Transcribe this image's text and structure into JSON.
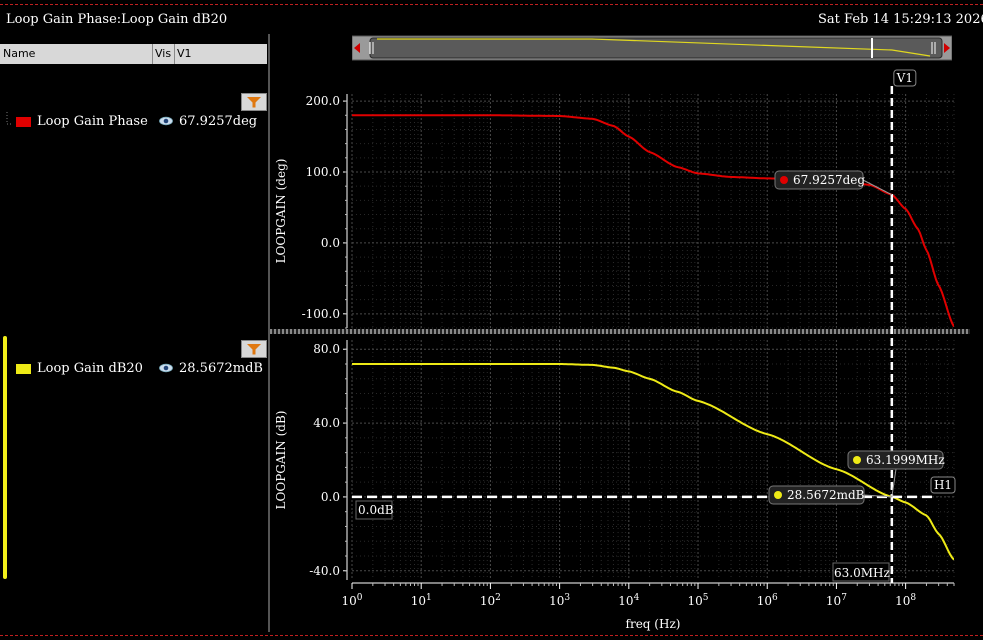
{
  "window": {
    "title": "Loop Gain Phase:Loop Gain dB20",
    "datetime": "Sat Feb 14 15:29:13 2026",
    "corner_text": "1"
  },
  "legend_header": {
    "name": "Name",
    "vis": "Vis",
    "v1": "V1"
  },
  "legend": [
    {
      "name": "Loop Gain Phase",
      "value": "67.9257deg",
      "color": "#e00000"
    },
    {
      "name": "Loop Gain dB20",
      "value": "28.5672mdB",
      "color": "#eeea16"
    }
  ],
  "markers": {
    "v1_label": "V1",
    "h1_label": "H1",
    "phase_readout": "67.9257deg",
    "freq_readout": "63.1999MHz",
    "gain_readout": "28.5672mdB",
    "h1_value_label": "0.0dB",
    "v1_freq_label": "63.0MHz"
  },
  "chart_data": [
    {
      "type": "line",
      "title": "",
      "xlabel": "freq (Hz)",
      "ylabel": "LOOPGAIN (deg)",
      "xscale": "log",
      "xlim": [
        1,
        500000000
      ],
      "ylim": [
        -120,
        210
      ],
      "yticks": [
        -100,
        0,
        100,
        200
      ],
      "ytick_labels": [
        "-100.0",
        "0.0",
        "100.0",
        "200.0"
      ],
      "grid": true,
      "series": [
        {
          "name": "Loop Gain Phase",
          "color": "#e00000",
          "x": [
            1,
            100,
            1000,
            3000,
            6000,
            10000,
            20000,
            50000,
            100000,
            300000,
            1000000,
            3000000,
            10000000,
            30000000,
            63200000,
            100000000,
            150000000,
            200000000,
            300000000,
            500000000
          ],
          "y": [
            180,
            180,
            179,
            175,
            165,
            150,
            128,
            107,
            98,
            93,
            91,
            90,
            88,
            82,
            68,
            48,
            20,
            -10,
            -60,
            -118
          ]
        }
      ]
    },
    {
      "type": "line",
      "title": "",
      "xlabel": "freq (Hz)",
      "ylabel": "LOOPGAIN (dB)",
      "xscale": "log",
      "xlim": [
        1,
        500000000
      ],
      "ylim": [
        -45,
        85
      ],
      "yticks": [
        -40,
        0,
        40,
        80
      ],
      "ytick_labels": [
        "-40.0",
        "0.0",
        "40.0",
        "80.0"
      ],
      "xtick_exponents": [
        0,
        1,
        2,
        3,
        4,
        5,
        6,
        7,
        8
      ],
      "grid": true,
      "series": [
        {
          "name": "Loop Gain dB20",
          "color": "#eeea16",
          "x": [
            1,
            100,
            1000,
            3000,
            6000,
            10000,
            20000,
            50000,
            100000,
            1000000,
            10000000,
            63200000,
            100000000,
            200000000,
            300000000,
            500000000
          ],
          "y": [
            72,
            72,
            72,
            71.5,
            70,
            68,
            64,
            57,
            52,
            34,
            15,
            0.03,
            -3,
            -10,
            -20,
            -34
          ]
        }
      ]
    }
  ]
}
